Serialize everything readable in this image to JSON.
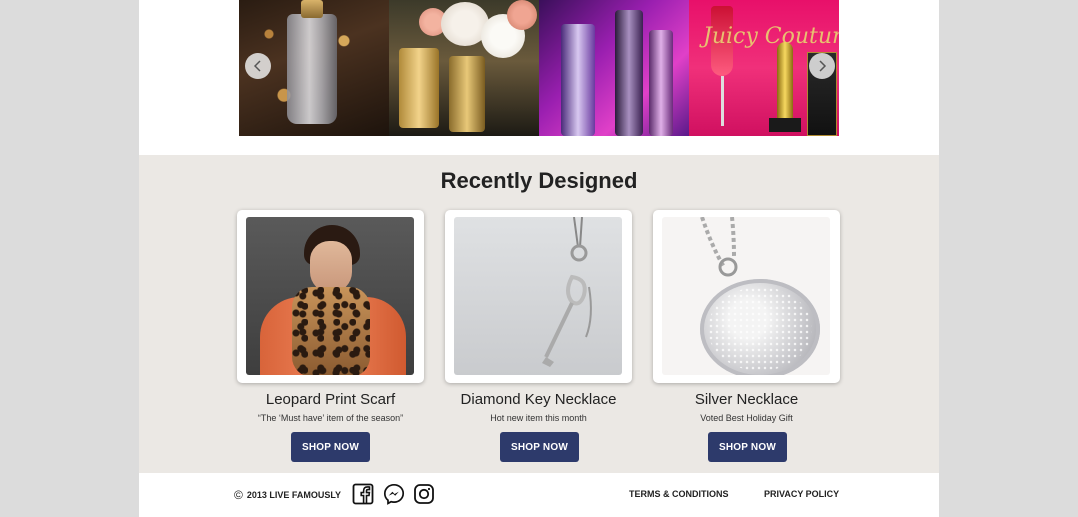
{
  "carousel": {
    "slides": [
      "slide-perfume-jewelry",
      "slide-perfume-roses",
      "slide-perfume-purple",
      "slide-juicy-couture"
    ],
    "slide4_text": "Juicy Couture",
    "prev_icon": "chevron-left-icon",
    "next_icon": "chevron-right-icon"
  },
  "recent": {
    "title": "Recently Designed",
    "products": [
      {
        "name": "Leopard Print Scarf",
        "desc": "“The ‘Must have’ item of the season”",
        "button": "SHOP NOW"
      },
      {
        "name": "Diamond Key Necklace",
        "desc": "Hot new item this month",
        "button": "SHOP NOW"
      },
      {
        "name": "Silver Necklace",
        "desc": "Voted Best Holiday Gift",
        "button": "SHOP NOW"
      }
    ]
  },
  "footer": {
    "copyright_symbol": "©",
    "copyright_text": "2013 LIVE FAMOUSLY",
    "social": [
      "facebook-icon",
      "messenger-icon",
      "instagram-icon"
    ],
    "terms": "TERMS & CONDITIONS",
    "privacy": "PRIVACY POLICY"
  },
  "colors": {
    "background": "#dcdcdc",
    "section_bg": "#ebe8e4",
    "button": "#2d3a6b"
  }
}
